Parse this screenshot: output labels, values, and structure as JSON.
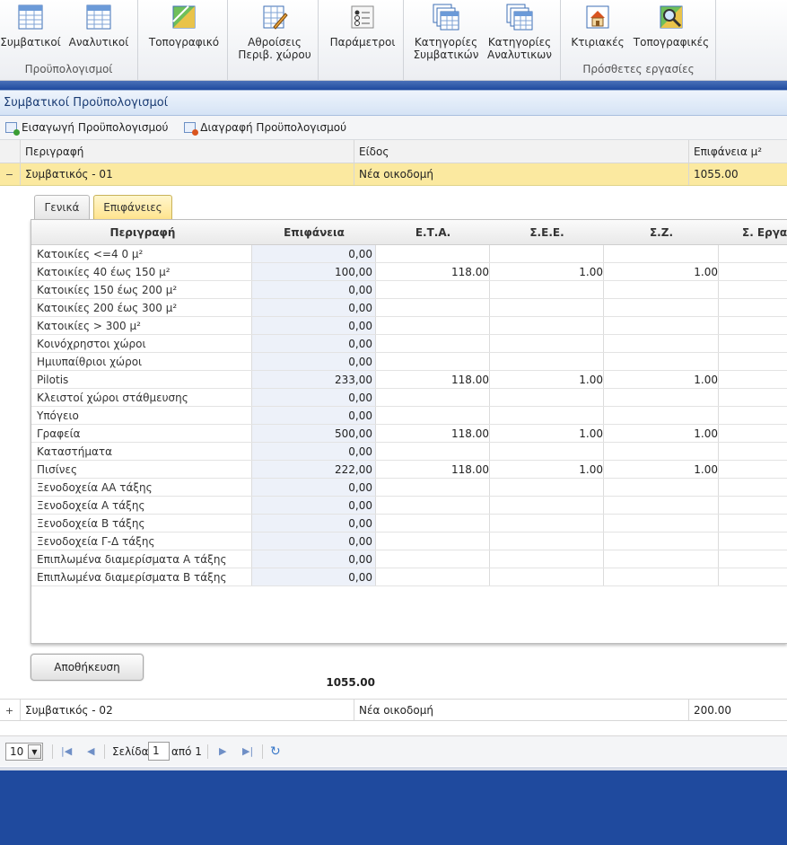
{
  "ribbon": {
    "buttons": [
      {
        "label": "Συμβατικοί",
        "icon": "table-icon"
      },
      {
        "label": "Αναλυτικοί",
        "icon": "table-icon"
      },
      {
        "label": "Τοπογραφικό",
        "icon": "map-icon"
      },
      {
        "label1": "Αθροίσεις",
        "label2": "Περιβ. χώρου",
        "icon": "edit-table-icon"
      },
      {
        "label": "Παράμετροι",
        "icon": "options-icon"
      },
      {
        "label1": "Κατηγορίες",
        "label2": "Συμβατικών",
        "icon": "stack-table-icon"
      },
      {
        "label1": "Κατηγορίες",
        "label2": "Αναλυτικων",
        "icon": "stack-table-icon"
      },
      {
        "label": "Κτιριακές",
        "icon": "house-icon"
      },
      {
        "label": "Τοπογραφικές",
        "icon": "map-search-icon"
      }
    ],
    "groups": {
      "budgets": "Προϋπολογισμοί",
      "extra": "Πρόσθετες εργασίες"
    }
  },
  "panel": {
    "title": "Συμβατικοί Προϋπολογισμοί",
    "toolbar": {
      "insert": "Εισαγωγή Προϋπολογισμού",
      "delete": "Διαγραφή Προϋπολογισμού"
    }
  },
  "grid": {
    "headers": {
      "desc": "Περιγραφή",
      "type": "Είδος",
      "area": "Επιφάνεια μ²"
    },
    "rows": [
      {
        "desc": "Συμβατικός - 01",
        "type": "Νέα οικοδομή",
        "area": "1055.00",
        "expander": "−"
      },
      {
        "desc": "Συμβατικός - 02",
        "type": "Νέα οικοδομή",
        "area": "200.00",
        "expander": "+"
      }
    ]
  },
  "tabs": {
    "general": "Γενικά",
    "surfaces": "Επιφάνειες"
  },
  "detail": {
    "headers": {
      "desc": "Περιγραφή",
      "surface": "Επιφάνεια",
      "eta": "Ε.Τ.Α.",
      "see": "Σ.Ε.Ε.",
      "sz": "Σ.Ζ.",
      "se": "Σ. Εργασ"
    },
    "rows": [
      {
        "desc": "Κατοικίες <=4 0 μ²",
        "surface": "0,00",
        "eta": "",
        "see": "",
        "sz": ""
      },
      {
        "desc": "Κατοικίες 40 έως 150 μ²",
        "surface": "100,00",
        "eta": "118.00",
        "see": "1.00",
        "sz": "1.00"
      },
      {
        "desc": "Κατοικίες 150 έως 200 μ²",
        "surface": "0,00",
        "eta": "",
        "see": "",
        "sz": ""
      },
      {
        "desc": "Κατοικίες 200 έως 300 μ²",
        "surface": "0,00",
        "eta": "",
        "see": "",
        "sz": ""
      },
      {
        "desc": "Κατοικίες > 300 μ²",
        "surface": "0,00",
        "eta": "",
        "see": "",
        "sz": ""
      },
      {
        "desc": "Κοινόχρηστοι χώροι",
        "surface": "0,00",
        "eta": "",
        "see": "",
        "sz": ""
      },
      {
        "desc": "Ημιυπαίθριοι χώροι",
        "surface": "0,00",
        "eta": "",
        "see": "",
        "sz": ""
      },
      {
        "desc": "Pilotis",
        "surface": "233,00",
        "eta": "118.00",
        "see": "1.00",
        "sz": "1.00"
      },
      {
        "desc": "Κλειστοί χώροι στάθμευσης",
        "surface": "0,00",
        "eta": "",
        "see": "",
        "sz": ""
      },
      {
        "desc": "Υπόγειο",
        "surface": "0,00",
        "eta": "",
        "see": "",
        "sz": ""
      },
      {
        "desc": "Γραφεία",
        "surface": "500,00",
        "eta": "118.00",
        "see": "1.00",
        "sz": "1.00"
      },
      {
        "desc": "Καταστήματα",
        "surface": "0,00",
        "eta": "",
        "see": "",
        "sz": ""
      },
      {
        "desc": "Πισίνες",
        "surface": "222,00",
        "eta": "118.00",
        "see": "1.00",
        "sz": "1.00"
      },
      {
        "desc": "Ξενοδοχεία ΑΑ τάξης",
        "surface": "0,00",
        "eta": "",
        "see": "",
        "sz": ""
      },
      {
        "desc": "Ξενοδοχεία Α τάξης",
        "surface": "0,00",
        "eta": "",
        "see": "",
        "sz": ""
      },
      {
        "desc": "Ξενοδοχεία Β τάξης",
        "surface": "0,00",
        "eta": "",
        "see": "",
        "sz": ""
      },
      {
        "desc": "Ξενοδοχεία Γ-Δ τάξης",
        "surface": "0,00",
        "eta": "",
        "see": "",
        "sz": ""
      },
      {
        "desc": "Επιπλωμένα διαμερίσματα Α τάξης",
        "surface": "0,00",
        "eta": "",
        "see": "",
        "sz": ""
      },
      {
        "desc": "Επιπλωμένα διαμερίσματα Β τάξης",
        "surface": "0,00",
        "eta": "",
        "see": "",
        "sz": ""
      }
    ],
    "total": "1055.00"
  },
  "save_label": "Αποθήκευση",
  "pager": {
    "page_size": "10",
    "page_label": "Σελίδα",
    "page": "1",
    "of_label": "από 1"
  }
}
